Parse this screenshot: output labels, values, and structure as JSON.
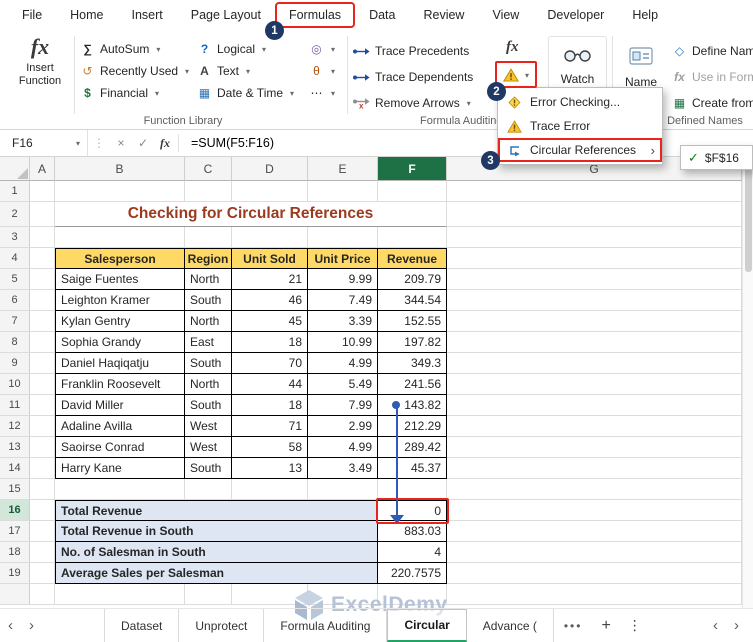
{
  "colors": {
    "annotation_red": "#e8251d",
    "badge_navy": "#1f3864",
    "table_header_fill": "#ffd966",
    "summary_fill": "#dde6f2",
    "title_color": "#9c3a1e",
    "selected_column_green": "#1e7145",
    "tracer_blue": "#2f5bb7",
    "active_tab_green": "#21a366"
  },
  "ribbon_tabs": [
    "File",
    "Home",
    "Insert",
    "Page Layout",
    "Formulas",
    "Data",
    "Review",
    "View",
    "Developer",
    "Help"
  ],
  "active_ribbon_tab": "Formulas",
  "annotations": {
    "step1": "1",
    "step2": "2",
    "step3": "3"
  },
  "ribbon": {
    "insert_function_line1": "Insert",
    "insert_function_line2": "Function",
    "function_library": {
      "group_label": "Function Library",
      "column1": [
        {
          "label": "AutoSum",
          "icon": "autosum-icon",
          "chevron": true
        },
        {
          "label": "Recently Used",
          "icon": "recently-used-icon",
          "chevron": true
        },
        {
          "label": "Financial",
          "icon": "financial-icon",
          "chevron": true
        }
      ],
      "column2": [
        {
          "label": "Logical",
          "icon": "logical-icon",
          "chevron": true
        },
        {
          "label": "Text",
          "icon": "text-icon",
          "chevron": true
        },
        {
          "label": "Date & Time",
          "icon": "date-time-icon",
          "chevron": true
        }
      ],
      "column3": [
        {
          "label": "",
          "icon": "lookup-reference-icon",
          "chevron": true
        },
        {
          "label": "",
          "icon": "math-trig-icon",
          "chevron": true
        },
        {
          "label": "",
          "icon": "more-functions-icon",
          "chevron": true
        }
      ]
    },
    "formula_auditing": {
      "group_label": "Formula Auditing",
      "buttons": [
        {
          "label": "Trace Precedents",
          "icon": "trace-precedents-icon"
        },
        {
          "label": "Trace Dependents",
          "icon": "trace-dependents-icon"
        },
        {
          "label": "Remove Arrows",
          "icon": "remove-arrows-icon",
          "chevron": true
        }
      ],
      "watch_label": "Watch"
    },
    "defined_names": {
      "group_label": "Defined Names",
      "name_label": "Name",
      "buttons": [
        {
          "label": "Define Nam",
          "icon": "define-name-icon"
        },
        {
          "label": "Use in Form",
          "icon": "use-in-formula-icon",
          "muted": true,
          "chevron": true
        },
        {
          "label": "Create from",
          "icon": "create-from-icon"
        }
      ]
    }
  },
  "dropdown_menu": {
    "items": [
      {
        "label": "Error Checking...",
        "icon": "error-checking-menu-icon"
      },
      {
        "label": "Trace Error",
        "icon": "trace-error-icon"
      },
      {
        "label": "Circular References",
        "icon": "circular-references-icon",
        "submenu": true
      }
    ],
    "highlighted_item": "Circular References",
    "submenu_value": "$F$16"
  },
  "formula_bar": {
    "name_box": "F16",
    "formula": "=SUM(F5:F16)"
  },
  "grid": {
    "column_letters": [
      "A",
      "B",
      "C",
      "D",
      "E",
      "F",
      "G"
    ],
    "selected_column": "F",
    "active_row": 16,
    "title": "Checking for Circular References",
    "table": {
      "headers": [
        "Salesperson",
        "Region",
        "Unit Sold",
        "Unit Price",
        "Revenue"
      ],
      "rows": [
        [
          "Saige Fuentes",
          "North",
          "21",
          "9.99",
          "209.79"
        ],
        [
          "Leighton Kramer",
          "South",
          "46",
          "7.49",
          "344.54"
        ],
        [
          "Kylan Gentry",
          "North",
          "45",
          "3.39",
          "152.55"
        ],
        [
          "Sophia Grandy",
          "East",
          "18",
          "10.99",
          "197.82"
        ],
        [
          "Daniel Haqiqatju",
          "South",
          "70",
          "4.99",
          "349.3"
        ],
        [
          "Franklin Roosevelt",
          "North",
          "44",
          "5.49",
          "241.56"
        ],
        [
          "David Miller",
          "South",
          "18",
          "7.99",
          "143.82"
        ],
        [
          "Adaline Avilla",
          "West",
          "71",
          "2.99",
          "212.29"
        ],
        [
          "Saoirse Conrad",
          "West",
          "58",
          "4.99",
          "289.42"
        ],
        [
          "Harry Kane",
          "South",
          "13",
          "3.49",
          "45.37"
        ]
      ]
    },
    "summary_rows": [
      {
        "row": 16,
        "label": "Total Revenue",
        "value": "0",
        "annotated": true
      },
      {
        "row": 17,
        "label": "Total Revenue in South",
        "value": "883.03"
      },
      {
        "row": 18,
        "label": "No. of Salesman in South",
        "value": "4"
      },
      {
        "row": 19,
        "label": "Average Sales per Salesman",
        "value": "220.7575"
      }
    ]
  },
  "sheet_tabs": {
    "tabs": [
      "Dataset",
      "Unprotect",
      "Formula Auditing",
      "Circular",
      "Advance ("
    ],
    "active_tab": "Circular",
    "watermark": "ExcelDemy"
  }
}
